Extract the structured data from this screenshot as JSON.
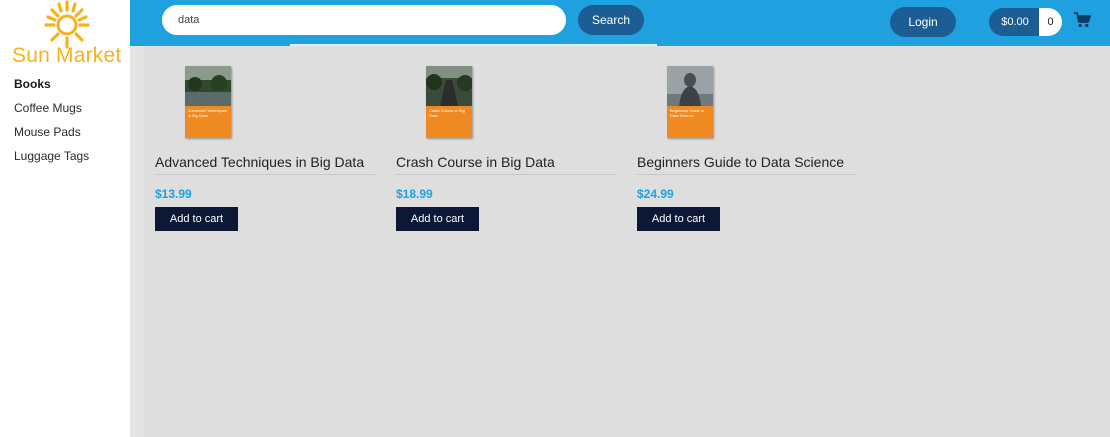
{
  "brand": {
    "name": "Sun Market",
    "color": "#f6b21c"
  },
  "sidebar": {
    "items": [
      {
        "label": "Books",
        "active": true
      },
      {
        "label": "Coffee Mugs"
      },
      {
        "label": "Mouse Pads"
      },
      {
        "label": "Luggage Tags"
      }
    ]
  },
  "header": {
    "search_value": "data",
    "search_button": "Search",
    "login_button": "Login",
    "cart_total": "$0.00",
    "cart_count": "0",
    "cart_icon": "shopping-cart-icon",
    "color": "#1ea1de"
  },
  "products": [
    {
      "title": "Advanced Techniques in Big Data",
      "price": "$13.99",
      "add_label": "Add to cart",
      "cover_text": "Advanced Techniques in Big Data",
      "cover_theme": "lake"
    },
    {
      "title": "Crash Course in Big Data",
      "price": "$18.99",
      "add_label": "Add to cart",
      "cover_text": "Crash Course in Big Data",
      "cover_theme": "road"
    },
    {
      "title": "Beginners Guide to Data Science",
      "price": "$24.99",
      "add_label": "Add to cart",
      "cover_text": "Beginners Guide to Data Science",
      "cover_theme": "statue"
    }
  ]
}
